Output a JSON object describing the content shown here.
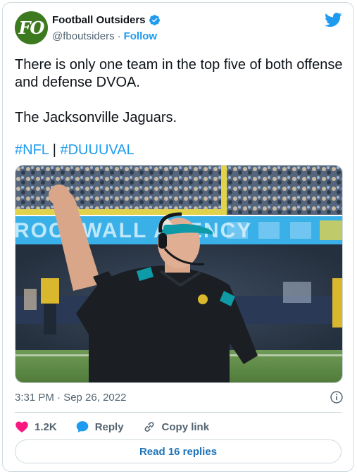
{
  "header": {
    "avatar_text": "FO",
    "display_name": "Football Outsiders",
    "handle": "@fboutsiders",
    "separator": "·",
    "follow_label": "Follow"
  },
  "tweet": {
    "line1": "There is only one team in the top five of both offense and defense DVOA.",
    "line2": "The Jacksonville Jaguars.",
    "hashtag1": "#NFL",
    "hashtag_separator": " | ",
    "hashtag2": "#DUUUVAL"
  },
  "photo": {
    "banner_text": "ROCKWALL AGENCY"
  },
  "footer": {
    "timestamp": "3:31 PM · Sep 26, 2022",
    "likes": "1.2K",
    "reply_label": "Reply",
    "copy_link_label": "Copy link",
    "read_replies_label": "Read 16 replies"
  },
  "colors": {
    "accent": "#1d9bf0",
    "heart": "#f91880",
    "avatar_bg": "#3d7a1f",
    "text_secondary": "#536471",
    "teal_cap": "#0e9aa7"
  }
}
